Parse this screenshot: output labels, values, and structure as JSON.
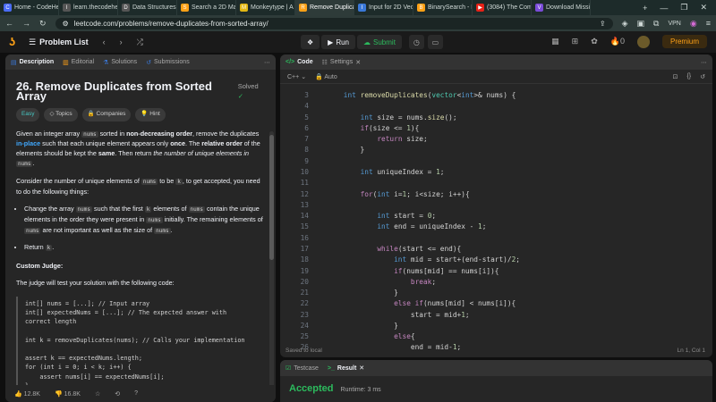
{
  "browser": {
    "tabs": [
      {
        "title": "Home - CodeHelp",
        "color": "#4a6cf7",
        "glyph": "C"
      },
      {
        "title": "learn.thecodehelp.in",
        "color": "#555",
        "glyph": "l"
      },
      {
        "title": "Data Structures and Alg",
        "color": "#555",
        "glyph": "D"
      },
      {
        "title": "Search a 2D Matrix",
        "color": "#ffa116",
        "glyph": "S"
      },
      {
        "title": "Monkeytype | A minimal",
        "color": "#e2b714",
        "glyph": "M"
      },
      {
        "title": "Remove Duplicates",
        "color": "#ffa116",
        "glyph": "R",
        "active": true
      },
      {
        "title": "Input for 2D Vector",
        "color": "#3a78d8",
        "glyph": "I"
      },
      {
        "title": "BinarySearch - LeetCode",
        "color": "#ffa116",
        "glyph": "B"
      },
      {
        "title": "(3084) The Complete",
        "color": "#e62117",
        "glyph": "▶"
      },
      {
        "title": "Download Missing",
        "color": "#7a4bd8",
        "glyph": "V"
      }
    ],
    "new_tab": "+",
    "url": "leetcode.com/problems/remove-duplicates-from-sorted-array/",
    "vpn": "VPN"
  },
  "lc": {
    "problem_list": "Problem List",
    "run": "Run",
    "submit": "Submit",
    "streak": "0",
    "premium": "Premium"
  },
  "left": {
    "tabs": [
      "Description",
      "Editorial",
      "Solutions",
      "Submissions"
    ],
    "title": "26. Remove Duplicates from Sorted Array",
    "solved": "Solved",
    "chips": [
      "Easy",
      "Topics",
      "Companies",
      "Hint"
    ],
    "p1": {
      "a": "Given an integer array ",
      "b": "nums",
      "c": " sorted in ",
      "d": "non-decreasing order",
      "e": ", remove the duplicates ",
      "f": "in-place",
      "g": " such that each unique element appears only ",
      "h": "once",
      "i": ". The ",
      "j": "relative order",
      "k": " of the elements should be kept the ",
      "l": "same",
      "m": ". Then return ",
      "n": "the number of unique elements in",
      "o": "nums",
      "p": "."
    },
    "p2": {
      "a": "Consider the number of unique elements of ",
      "b": "nums",
      "c": " to be ",
      "d": "k",
      "e": ", to get accepted, you need to do the following things:"
    },
    "li1": {
      "a": "Change the array ",
      "b": "nums",
      "c": " such that the first ",
      "d": "k",
      "e": " elements of ",
      "f": "nums",
      "g": " contain the unique elements in the order they were present in ",
      "h": "nums",
      "i": " initially. The remaining elements of ",
      "j": "nums",
      "k": " are not important as well as the size of ",
      "l": "nums",
      "m": "."
    },
    "li2": {
      "a": "Return ",
      "b": "k",
      "c": "."
    },
    "judge_title": "Custom Judge:",
    "judge_text": "The judge will test your solution with the following code:",
    "judge_code": "int[] nums = [...]; // Input array\nint[] expectedNums = [...]; // The expected answer with\ncorrect length\n\nint k = removeDuplicates(nums); // Calls your implementation\n\nassert k == expectedNums.length;\nfor (int i = 0; i < k; i++) {\n    assert nums[i] == expectedNums[i];\n}",
    "likes": "12.8K",
    "dislikes": "16.8K"
  },
  "editor": {
    "tabs": [
      "Code",
      "Settings"
    ],
    "language": "C++",
    "mode": "Auto",
    "line_numbers": [
      "3",
      "4",
      "5",
      "6",
      "7",
      "8",
      "9",
      "10",
      "11",
      "12",
      "13",
      "14",
      "15",
      "16",
      "17",
      "18",
      "19",
      "20",
      "21",
      "22",
      "23",
      "24",
      "25",
      "26"
    ],
    "saved": "Saved to local",
    "position": "Ln 1, Col 1"
  },
  "result": {
    "tabs": [
      "Testcase",
      "Result"
    ],
    "status": "Accepted",
    "runtime": "Runtime: 3 ms"
  }
}
